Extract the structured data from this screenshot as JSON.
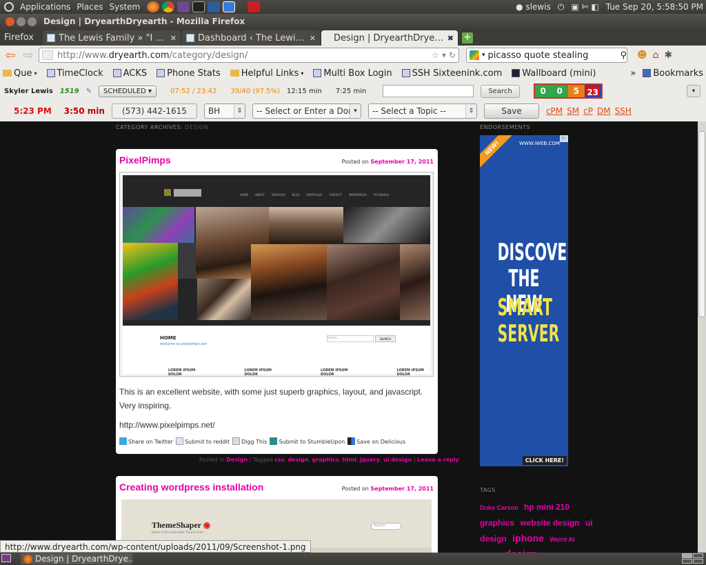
{
  "top_panel": {
    "menus": [
      "Applications",
      "Places",
      "System"
    ],
    "user": "slewis",
    "datetime": "Tue Sep 20,  5:58:50 PM"
  },
  "window": {
    "title": "Design | DryearthDryearth - Mozilla Firefox"
  },
  "tabs": {
    "firefox_menu": "Firefox",
    "items": [
      {
        "label": "The Lewis Family » \"I will ..."
      },
      {
        "label": "Dashboard ‹ The Lewis Fa..."
      },
      {
        "label": "Design | DryearthDryearth"
      }
    ]
  },
  "navbar": {
    "url_prefix": "http://www.",
    "url_domain": "dryearth.com",
    "url_path": "/category/design/",
    "search_query": "picasso quote stealing"
  },
  "bookmarks": {
    "items": [
      "Que",
      "TimeClock",
      "ACKS",
      "Phone Stats",
      "Helpful Links",
      "Multi Box Login",
      "SSH Sixteenink.com",
      "Wallboard (mini)"
    ],
    "overflow": "»",
    "menu": "Bookmarks"
  },
  "toolbar1": {
    "user": "Skyler Lewis",
    "user_id": "1519",
    "status": "SCHEDULED",
    "time_range": "07:52 / 23:42",
    "ratio": "39/40 (97.5%)",
    "min1": "12:15 min",
    "min2": "7:25 min",
    "search_label": "Search",
    "counters": [
      "0",
      "0",
      "5",
      "23"
    ],
    "counter_colors": [
      "#2ea84a",
      "#2ea84a",
      "#ee7d12",
      "#d4141b"
    ]
  },
  "toolbar2": {
    "clock": "5:23 PM",
    "duration": "3:50 min",
    "phone": "(573) 442-1615",
    "bh": "BH",
    "donor_placeholder": "-- Select or Enter a Don",
    "topic_placeholder": "-- Select a Topic --",
    "save": "Save",
    "links": [
      "cPM",
      "SM",
      "cP",
      "DM",
      "SSH"
    ]
  },
  "page": {
    "category_prefix": "CATEGORY ARCHIVES:",
    "category_term": "DESIGN",
    "post1": {
      "title": "PixelPimps",
      "posted_on": "Posted on",
      "date": "September 17, 2011",
      "shot": {
        "nav": [
          "HOME",
          "ABOUT",
          "SERVICES",
          "BLOG",
          "PORTFOLIO",
          "CONTACT",
          "WORDPRESS",
          "TUTORIALS"
        ],
        "home": "HOME",
        "welcome": "welcome to pixelpimps.net",
        "search_field": "Search...",
        "search_button": "SEARCH",
        "lorem": [
          "LOREM IPSUM DOLOR",
          "LOREM IPSUM DOLOR",
          "LOREM IPSUM DOLOR",
          "LOREM IPSUM DOLOR"
        ]
      },
      "body1": "This is an excellent website, with some just superb graphics, layout, and javascript. Very inspiring.",
      "body2": "http://www.pixelpimps.net/",
      "share": [
        "Share on Twitter",
        "Submit to reddit",
        "Digg This",
        "Submit to StumbleUpon",
        "Save on Delicious"
      ],
      "meta": {
        "posted_in": "Posted in",
        "category": "Design",
        "tagged": "| Tagged",
        "tags": [
          "css",
          "design",
          "graphics",
          "html",
          "jquery",
          "ui design"
        ],
        "reply": "Leave a reply"
      }
    },
    "post2": {
      "title": "Creating wordpress installation",
      "posted_on": "Posted on",
      "date": "September 17, 2011",
      "shot": {
        "brand": "ThemeShaper",
        "sub": "Home of the Automattic Theme Team",
        "search": "Search"
      }
    },
    "sidebar": {
      "endorsements": "ENDORSEMENTS",
      "ad": {
        "ribbon": "NEW!",
        "brand": "WWW.iWEB.COM",
        "lines": [
          "DISCOVER",
          "THE NEW",
          "SMART",
          "SERVER"
        ],
        "cta": "CLICK HERE!"
      },
      "tags_head": "TAGS",
      "tags": [
        {
          "t": "Duke Carson",
          "s": 9
        },
        {
          "t": "hp mini 210",
          "s": 12
        },
        {
          "t": "graphics",
          "s": 12
        },
        {
          "t": "website design",
          "s": 12
        },
        {
          "t": "ui design",
          "s": 12
        },
        {
          "t": "iphone",
          "s": 14
        },
        {
          "t": "Weird Al",
          "s": 9
        },
        {
          "t": "design",
          "s": 15
        }
      ]
    }
  },
  "status_url": "http://www.dryearth.com/wp-content/uploads/2011/09/Screenshot-1.png",
  "taskbar": {
    "item": "Design | DryearthDrye..."
  }
}
